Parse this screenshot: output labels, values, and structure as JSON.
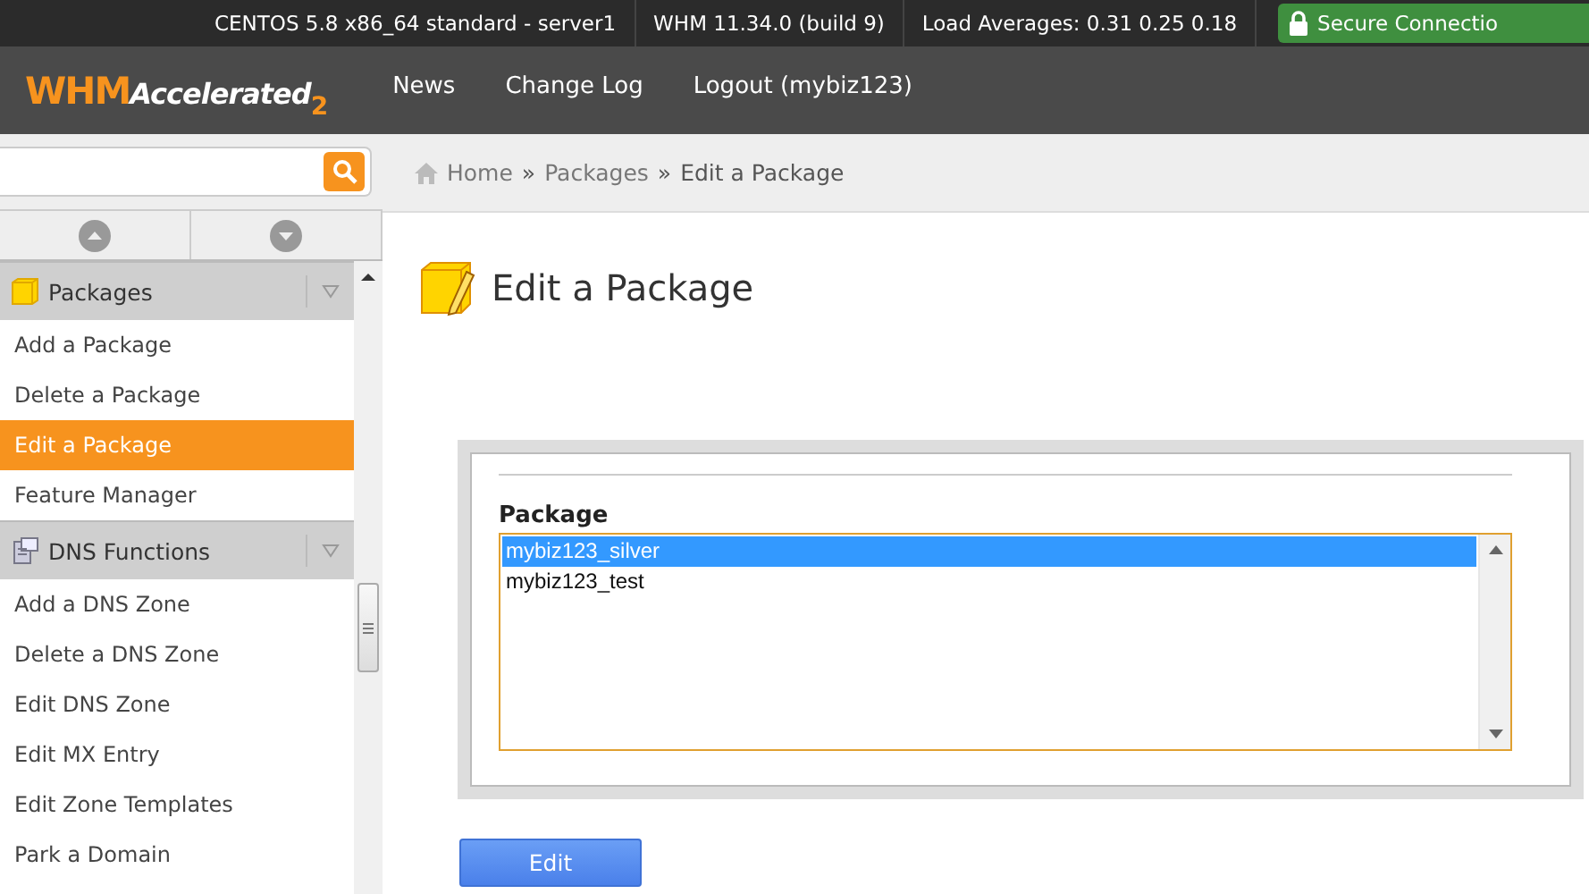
{
  "status_bar": {
    "items": [
      "CENTOS 5.8 x86_64 standard - server1",
      "WHM 11.34.0 (build 9)",
      "Load Averages: 0.31 0.25 0.18"
    ],
    "secure": "Secure Connectio"
  },
  "logo": {
    "word": "WHM",
    "sub": "Accelerated",
    "version": "2"
  },
  "nav": [
    "News",
    "Change Log",
    "Logout (mybiz123)"
  ],
  "breadcrumb": {
    "items": [
      "Home",
      "Packages",
      "Edit a Package"
    ],
    "separator": "»"
  },
  "sidebar": {
    "groups": [
      {
        "kind": "packages",
        "title": "Packages",
        "items": [
          {
            "label": "Add a Package",
            "selected": false
          },
          {
            "label": "Delete a Package",
            "selected": false
          },
          {
            "label": "Edit a Package",
            "selected": true
          },
          {
            "label": "Feature Manager",
            "selected": false
          }
        ]
      },
      {
        "kind": "dns",
        "title": "DNS Functions",
        "items": [
          {
            "label": "Add a DNS Zone",
            "selected": false
          },
          {
            "label": "Delete a DNS Zone",
            "selected": false
          },
          {
            "label": "Edit DNS Zone",
            "selected": false
          },
          {
            "label": "Edit MX Entry",
            "selected": false
          },
          {
            "label": "Edit Zone Templates",
            "selected": false
          },
          {
            "label": "Park a Domain",
            "selected": false
          }
        ]
      }
    ]
  },
  "page_title": "Edit a Package",
  "form": {
    "label": "Package",
    "options": [
      {
        "label": "mybiz123_silver",
        "selected": true
      },
      {
        "label": "mybiz123_test",
        "selected": false
      }
    ],
    "button": "Edit"
  }
}
